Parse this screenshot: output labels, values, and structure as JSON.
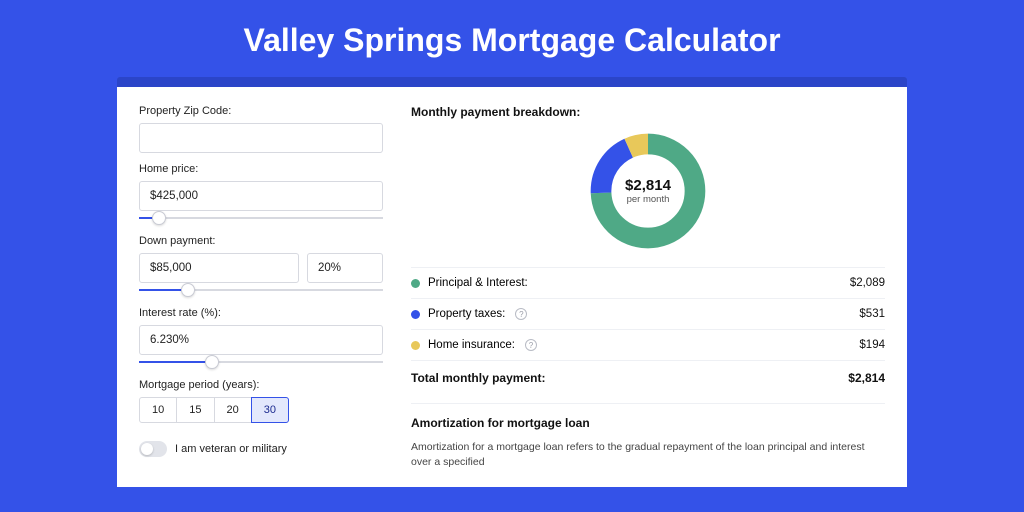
{
  "page_title": "Valley Springs Mortgage Calculator",
  "form": {
    "zip_label": "Property Zip Code:",
    "zip_value": "",
    "home_price_label": "Home price:",
    "home_price_value": "$425,000",
    "home_price_slider_percent": 8,
    "down_payment_label": "Down payment:",
    "down_payment_value": "$85,000",
    "down_payment_pct": "20%",
    "down_payment_slider_percent": 20,
    "interest_label": "Interest rate (%):",
    "interest_value": "6.230%",
    "interest_slider_percent": 30,
    "term_label": "Mortgage period (years):",
    "terms": [
      "10",
      "15",
      "20",
      "30"
    ],
    "term_selected": "30",
    "veteran_label": "I am veteran or military",
    "veteran_on": false
  },
  "breakdown": {
    "title": "Monthly payment breakdown:",
    "center_amount": "$2,814",
    "center_caption": "per month",
    "items": [
      {
        "label": "Principal & Interest:",
        "value": "$2,089",
        "color": "#4fa986",
        "has_help": false
      },
      {
        "label": "Property taxes:",
        "value": "$531",
        "color": "#3452e8",
        "has_help": true
      },
      {
        "label": "Home insurance:",
        "value": "$194",
        "color": "#e8c85a",
        "has_help": true
      }
    ],
    "total_label": "Total monthly payment:",
    "total_value": "$2,814"
  },
  "chart_data": {
    "type": "pie",
    "title": "Monthly payment breakdown",
    "series": [
      {
        "name": "Principal & Interest",
        "value": 2089,
        "color": "#4fa986"
      },
      {
        "name": "Property taxes",
        "value": 531,
        "color": "#3452e8"
      },
      {
        "name": "Home insurance",
        "value": 194,
        "color": "#e8c85a"
      }
    ],
    "total": 2814,
    "center_label": "$2,814 per month"
  },
  "amortization": {
    "title": "Amortization for mortgage loan",
    "text": "Amortization for a mortgage loan refers to the gradual repayment of the loan principal and interest over a specified"
  }
}
